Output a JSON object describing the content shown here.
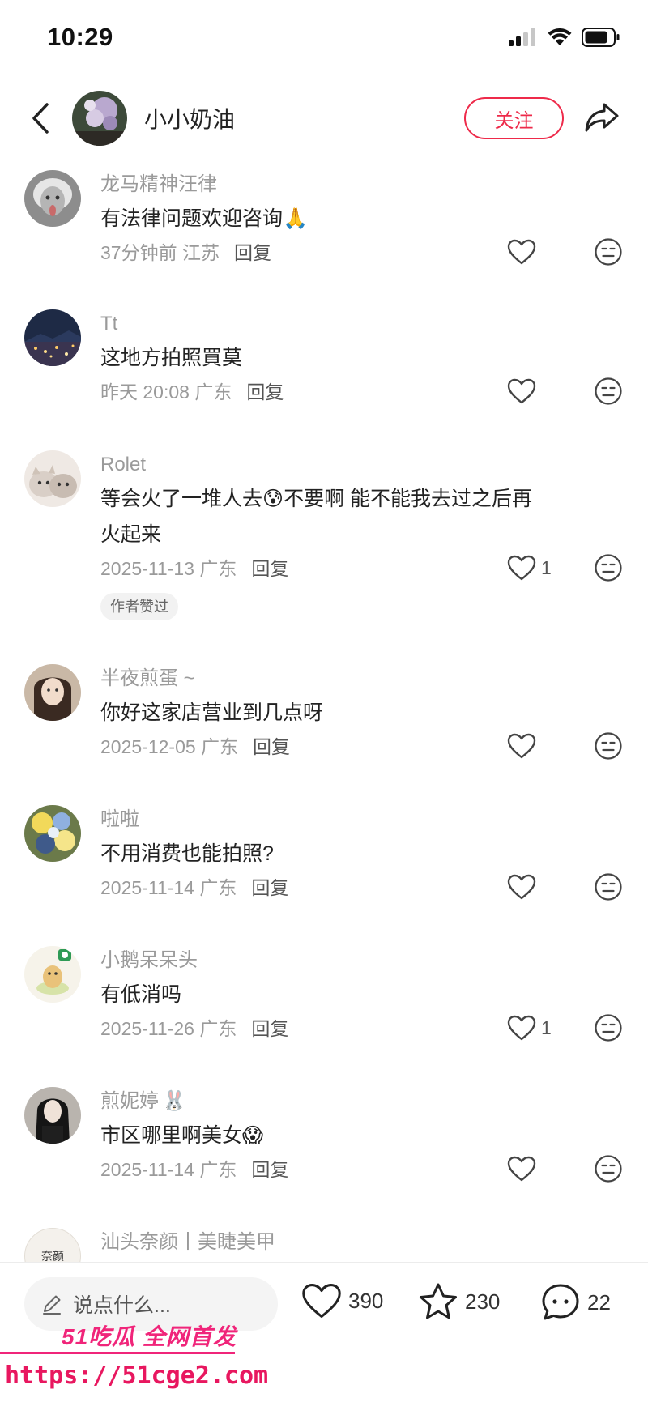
{
  "status_bar": {
    "time": "10:29"
  },
  "header": {
    "title": "小小奶油",
    "follow_label": "关注"
  },
  "comments": [
    {
      "name": "龙马精神汪律",
      "name_emoji": "",
      "text": "有法律问题欢迎咨询",
      "text_emoji": "🙏",
      "text_after": "",
      "time": "37分钟前",
      "location": "江苏",
      "reply": "回复",
      "likes": "",
      "badge": ""
    },
    {
      "name": "Tt",
      "name_emoji": "",
      "text": "这地方拍照買莫",
      "text_emoji": "",
      "text_after": "",
      "time": "昨天 20:08",
      "location": "广东",
      "reply": "回复",
      "likes": "",
      "badge": ""
    },
    {
      "name": "Rolet",
      "name_emoji": "",
      "text": "等会火了一堆人去",
      "text_emoji": "😰",
      "text_after": "不要啊 能不能我去过之后再火起来",
      "time": "2025-11-13",
      "location": "广东",
      "reply": "回复",
      "likes": "1",
      "badge": "作者赞过"
    },
    {
      "name": "半夜煎蛋 ~",
      "name_emoji": "",
      "text": "你好这家店营业到几点呀",
      "text_emoji": "",
      "text_after": "",
      "time": "2025-12-05",
      "location": "广东",
      "reply": "回复",
      "likes": "",
      "badge": ""
    },
    {
      "name": "啦啦",
      "name_emoji": "",
      "text": "不用消费也能拍照?",
      "text_emoji": "",
      "text_after": "",
      "time": "2025-11-14",
      "location": "广东",
      "reply": "回复",
      "likes": "",
      "badge": ""
    },
    {
      "name": "小鹅呆呆头",
      "name_emoji": "",
      "text": "有低消吗",
      "text_emoji": "",
      "text_after": "",
      "time": "2025-11-26",
      "location": "广东",
      "reply": "回复",
      "likes": "1",
      "badge": ""
    },
    {
      "name": "煎妮婷",
      "name_emoji": "🐰",
      "text": "市区哪里啊美女",
      "text_emoji": "😱",
      "text_after": "",
      "time": "2025-11-14",
      "location": "广东",
      "reply": "回复",
      "likes": "",
      "badge": ""
    },
    {
      "name": "汕头奈颜丨美睫美甲",
      "name_emoji": "",
      "text": "",
      "text_emoji": "",
      "text_after": "",
      "time": "",
      "location": "",
      "reply": "",
      "likes": "",
      "badge": "",
      "avatar_text": "奈颜"
    }
  ],
  "bottom_bar": {
    "input_placeholder": "说点什么...",
    "likes": "390",
    "favorites": "230",
    "comments": "22"
  },
  "watermark": {
    "line1": "51吃瓜 全网首发",
    "line2": "https://51cge2.com"
  },
  "colors": {
    "accent": "#ee2a4a",
    "watermark": "#f0257a",
    "meta_gray": "#9a9a9a"
  }
}
